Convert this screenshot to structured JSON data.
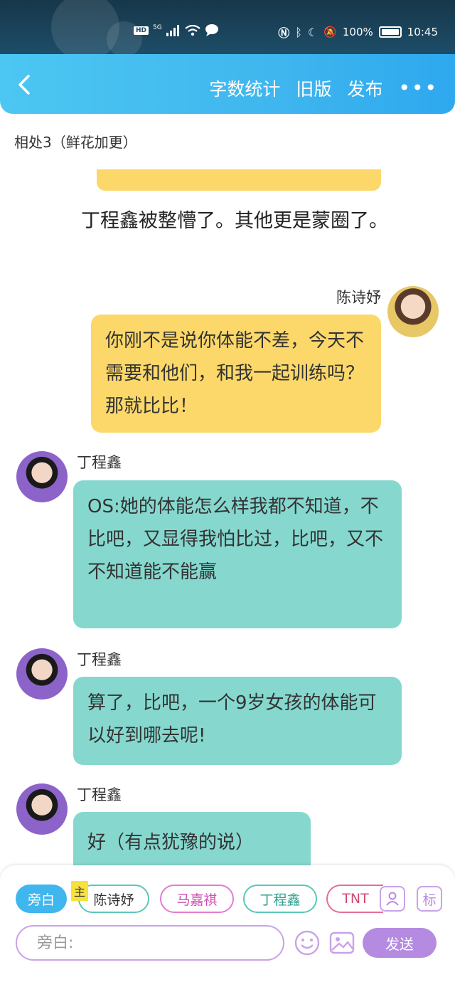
{
  "status_bar": {
    "hd": "HD",
    "network": "5G",
    "battery_percent": "100%",
    "time": "10:45"
  },
  "header": {
    "word_count": "字数统计",
    "old_version": "旧版",
    "publish": "发布",
    "more": "•••"
  },
  "chapter_title": "相处3（鲜花加更）",
  "messages": [
    {
      "type": "narration",
      "text": "丁程鑫被整懵了。其他更是蒙圈了。"
    },
    {
      "type": "chat",
      "speaker": "陈诗妤",
      "text": "你刚不是说你体能不差，今天不需要和他们，和我一起训练吗？那就比比！"
    },
    {
      "type": "chat",
      "speaker": "丁程鑫",
      "text": "OS:她的体能怎么样我都不知道，不比吧，又显得我怕比过，比吧，又不不知道能不能赢"
    },
    {
      "type": "chat",
      "speaker": "丁程鑫",
      "text": "算了，比吧，一个9岁女孩的体能可以好到哪去呢!"
    },
    {
      "type": "chat",
      "speaker": "丁程鑫",
      "text": "好（有点犹豫的说）"
    }
  ],
  "role_bar": {
    "narrator": "旁白",
    "main_tag": "主",
    "roles": [
      "陈诗妤",
      "马嘉祺",
      "丁程鑫",
      "TNT"
    ],
    "tag_button": "标"
  },
  "composer": {
    "placeholder": "旁白:",
    "send": "发送"
  }
}
